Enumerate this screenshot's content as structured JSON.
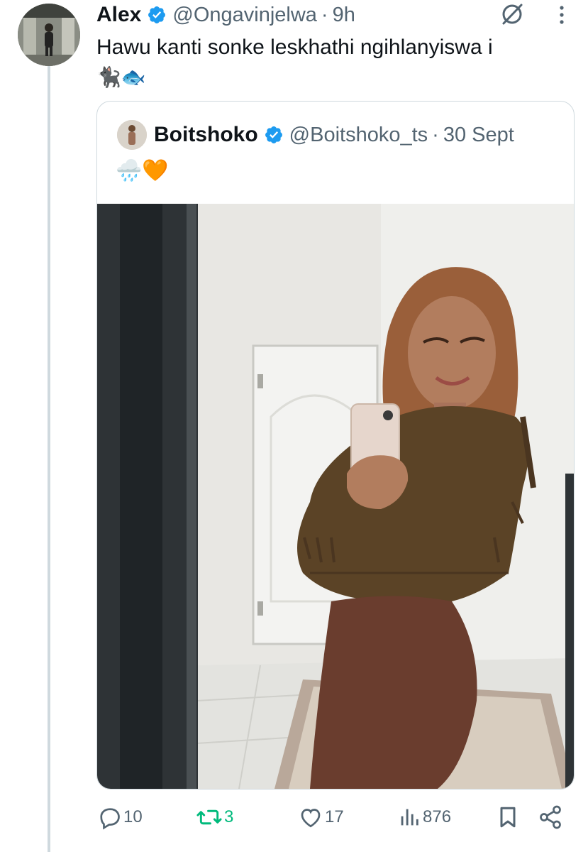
{
  "tweet": {
    "author_name": "Alex",
    "handle": "@Ongavinjelwa",
    "separator": "·",
    "time": "9h",
    "text": "Hawu kanti sonke leskhathi ngihlanyiswa i",
    "emojis": "🐈‍⬛🐟"
  },
  "quoted_tweet": {
    "author_name": "Boitshoko",
    "handle": "@Boitshoko_ts",
    "separator": "·",
    "date": "30 Sept",
    "text": "🌧️🧡"
  },
  "actions": {
    "replies": "10",
    "retweets": "3",
    "likes": "17",
    "views": "876"
  },
  "icons": [
    "verified-badge-icon",
    "grok-icon",
    "more-icon",
    "reply-icon",
    "retweet-icon",
    "like-icon",
    "views-icon",
    "bookmark-icon",
    "share-icon"
  ],
  "colors": {
    "verified": "#1d9bf0",
    "retweet_active": "#00ba7c",
    "muted": "#536471",
    "thread_line": "#cfd9de"
  }
}
